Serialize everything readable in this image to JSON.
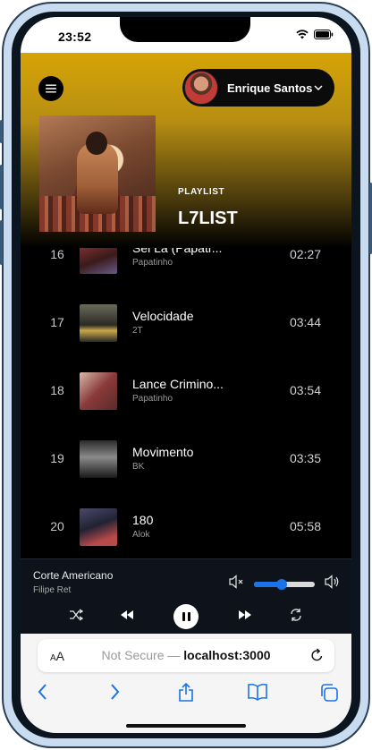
{
  "status_bar": {
    "time": "23:52"
  },
  "header": {
    "user_name": "Enrique Santos",
    "playlist_label": "PLAYLIST",
    "playlist_name": "L7LIST"
  },
  "tracks": [
    {
      "number": "16",
      "title": "Sei Lá (Papatr...",
      "artist": "Papatinho",
      "duration": "02:27",
      "art_colors": [
        "#3a1a1a",
        "#a33a3a"
      ]
    },
    {
      "number": "17",
      "title": "Velocidade",
      "artist": "2T",
      "duration": "03:44",
      "art_colors": [
        "#4a4438",
        "#c9a84a"
      ]
    },
    {
      "number": "18",
      "title": "Lance Crimino...",
      "artist": "Papatinho",
      "duration": "03:54",
      "art_colors": [
        "#5a2a2a",
        "#d6b8a8"
      ]
    },
    {
      "number": "19",
      "title": "Movimento",
      "artist": "BK",
      "duration": "03:35",
      "art_colors": [
        "#1a1a1a",
        "#8a8a8a"
      ]
    },
    {
      "number": "20",
      "title": "180",
      "artist": "Alok",
      "duration": "05:58",
      "art_colors": [
        "#222233",
        "#b84a4a"
      ]
    }
  ],
  "player": {
    "now_playing_title": "Corte Americano",
    "now_playing_artist": "Filipe Ret",
    "volume": 0.45,
    "accent_color": "#1a73e8"
  },
  "browser": {
    "text_size_label": "AA",
    "url_prefix": "Not Secure —",
    "url_host": "localhost:3000"
  }
}
